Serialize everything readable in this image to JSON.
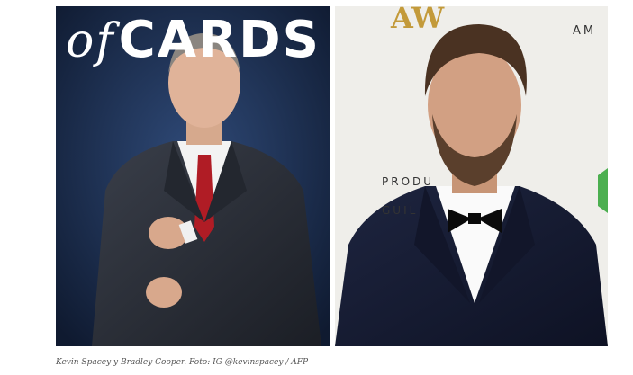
{
  "left_photo": {
    "poster_word_1": "of",
    "poster_word_2": "CARDS"
  },
  "right_photo": {
    "backdrop_top": "AM",
    "backdrop_gold": "AW",
    "backdrop_line_1": "PRODU",
    "backdrop_line_2": "GUIL"
  },
  "caption": "Kevin Spacey y Bradley Cooper. Foto: IG @kevinspacey / AFP",
  "colors": {
    "left_background": "#1a2a4a",
    "right_background": "#efeeea",
    "caption_text": "#555555"
  }
}
